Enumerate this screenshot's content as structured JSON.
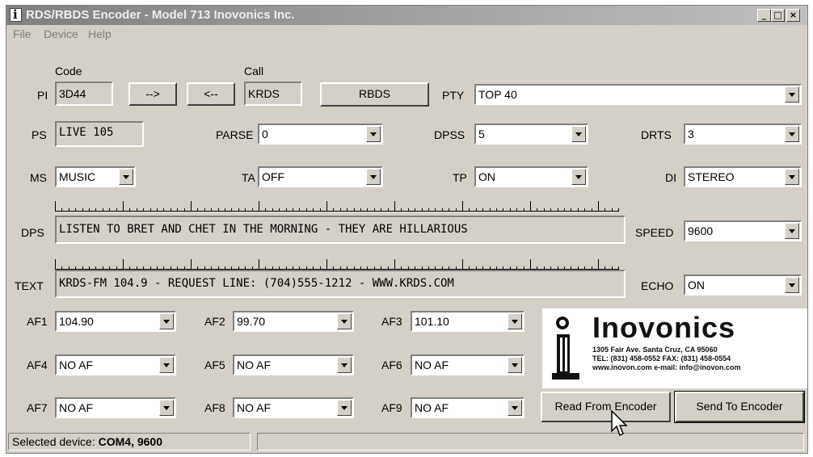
{
  "window": {
    "title": "RDS/RBDS Encoder - Model 713 Inovonics Inc."
  },
  "menu": [
    "File",
    "Device",
    "Help"
  ],
  "pi": {
    "code_header": "Code",
    "call_header": "Call",
    "label": "PI",
    "code": "3D44",
    "call": "KRDS",
    "to_call_btn": "-->",
    "to_code_btn": "<--",
    "mode_btn": "RBDS"
  },
  "pty": {
    "label": "PTY",
    "value": "TOP 40"
  },
  "ps": {
    "label": "PS",
    "value": "LIVE 105"
  },
  "parse": {
    "label": "PARSE",
    "value": "0"
  },
  "dpss": {
    "label": "DPSS",
    "value": "5"
  },
  "drts": {
    "label": "DRTS",
    "value": "3"
  },
  "ms": {
    "label": "MS",
    "value": "MUSIC"
  },
  "ta": {
    "label": "TA",
    "value": "OFF"
  },
  "tp": {
    "label": "TP",
    "value": "ON"
  },
  "di": {
    "label": "DI",
    "value": "STEREO"
  },
  "dps": {
    "label": "DPS",
    "value": "LISTEN TO BRET AND CHET IN THE MORNING - THEY ARE HILLARIOUS"
  },
  "speed": {
    "label": "SPEED",
    "value": "9600"
  },
  "text": {
    "label": "TEXT",
    "value": "KRDS-FM 104.9 - REQUEST LINE: (704)555-1212 - WWW.KRDS.COM"
  },
  "echo": {
    "label": "ECHO",
    "value": "ON"
  },
  "af": [
    {
      "label": "AF1",
      "value": "104.90"
    },
    {
      "label": "AF2",
      "value": "99.70"
    },
    {
      "label": "AF3",
      "value": "101.10"
    },
    {
      "label": "AF4",
      "value": "NO AF"
    },
    {
      "label": "AF5",
      "value": "NO AF"
    },
    {
      "label": "AF6",
      "value": "NO AF"
    },
    {
      "label": "AF7",
      "value": "NO AF"
    },
    {
      "label": "AF8",
      "value": "NO AF"
    },
    {
      "label": "AF9",
      "value": "NO AF"
    }
  ],
  "logo": {
    "name": "Inovonics",
    "address": "1305 Fair Ave. Santa Cruz, CA 95060",
    "phone": "TEL: (831) 458-0552 FAX: (831) 458-0554",
    "web": "www.inovon.com e-mail: info@inovon.com"
  },
  "buttons": {
    "read": "Read From Encoder",
    "send": "Send To Encoder"
  },
  "status": {
    "label": "Selected device:",
    "value": "COM4, 9600"
  }
}
